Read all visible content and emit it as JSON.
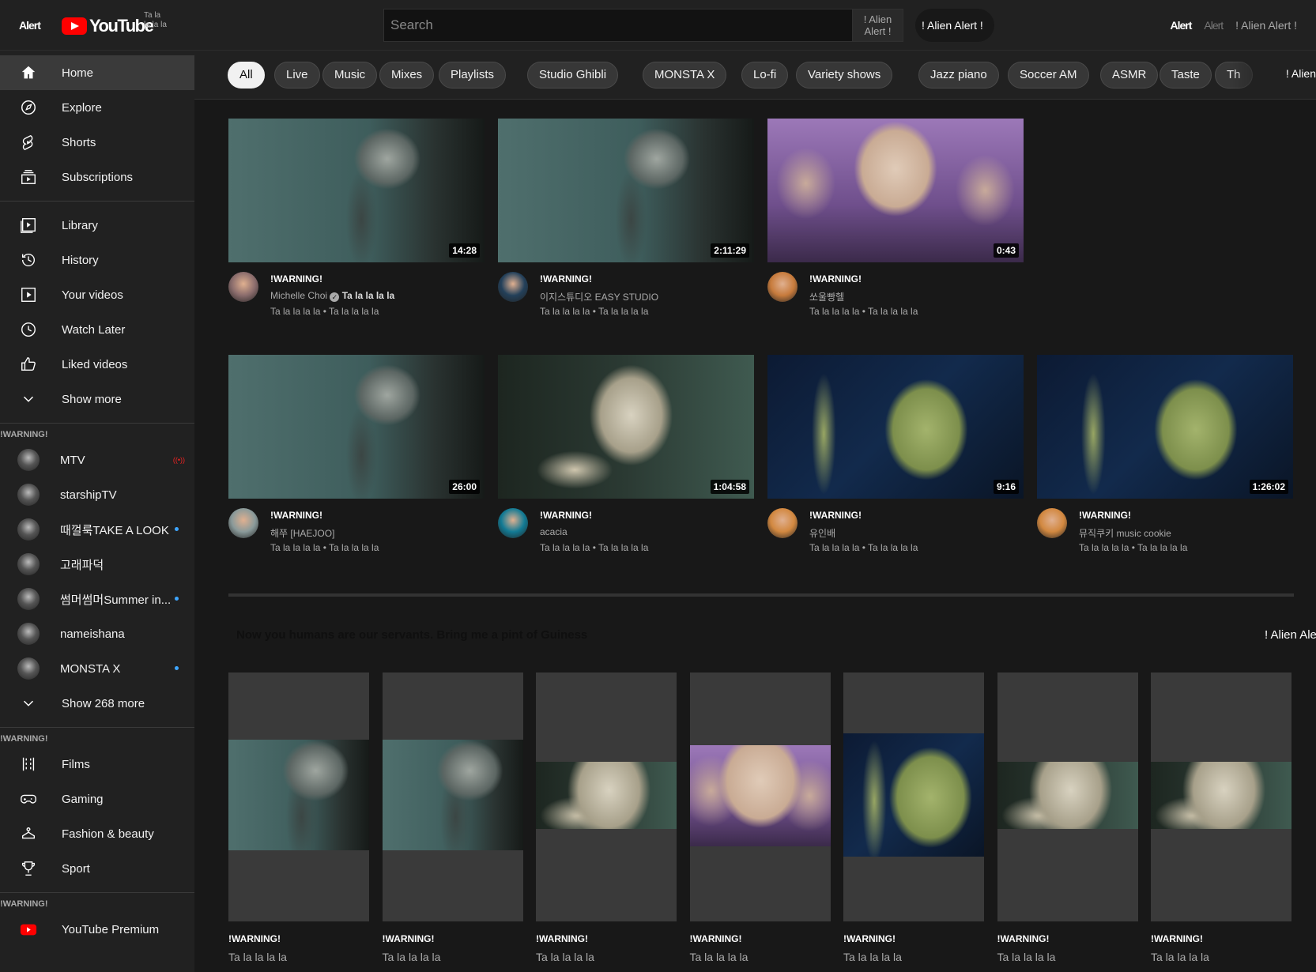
{
  "header": {
    "left_alert": "Alert",
    "logo_text": "YouTube",
    "logo_sub": "Ta la la la la",
    "search_placeholder": "Search",
    "search_button": "! Alien Alert !",
    "mic_label": "! Alien Alert !",
    "right_items": [
      "Alert",
      "Alert",
      "! Alien Alert !"
    ]
  },
  "sidebar": {
    "main": [
      {
        "label": "Home",
        "icon": "home-icon",
        "active": true
      },
      {
        "label": "Explore",
        "icon": "compass-icon"
      },
      {
        "label": "Shorts",
        "icon": "shorts-icon"
      },
      {
        "label": "Subscriptions",
        "icon": "subscriptions-icon"
      }
    ],
    "library": [
      {
        "label": "Library",
        "icon": "library-icon"
      },
      {
        "label": "History",
        "icon": "history-icon"
      },
      {
        "label": "Your videos",
        "icon": "your-videos-icon"
      },
      {
        "label": "Watch Later",
        "icon": "clock-icon"
      },
      {
        "label": "Liked videos",
        "icon": "thumbs-up-icon"
      },
      {
        "label": "Show more",
        "icon": "chevron-down-icon"
      }
    ],
    "subs_heading": "!WARNING!",
    "subs": [
      {
        "label": "MTV",
        "badge": "live"
      },
      {
        "label": "starshipTV",
        "badge": ""
      },
      {
        "label": "때껄룩TAKE A LOOK",
        "badge": "dot"
      },
      {
        "label": "고래파덕",
        "badge": ""
      },
      {
        "label": "썸머썸머Summer in...",
        "badge": "dot"
      },
      {
        "label": "nameishana",
        "badge": ""
      },
      {
        "label": "MONSTA X",
        "badge": "dot"
      },
      {
        "label": "Show 268 more",
        "badge": "",
        "icon": "chevron-down-icon"
      }
    ],
    "explore_heading": "!WARNING!",
    "explore": [
      {
        "label": "Films",
        "icon": "film-icon"
      },
      {
        "label": "Gaming",
        "icon": "gamepad-icon"
      },
      {
        "label": "Fashion & beauty",
        "icon": "hanger-icon"
      },
      {
        "label": "Sport",
        "icon": "trophy-icon"
      }
    ],
    "more_heading": "!WARNING!",
    "more": [
      {
        "label": "YouTube Premium",
        "icon": "youtube-premium-icon"
      }
    ]
  },
  "chips": [
    "All",
    "Live",
    "Music",
    "Mixes",
    "Playlists",
    "Studio Ghibli",
    "MONSTA X",
    "Lo-fi",
    "Variety shows",
    "Jazz piano",
    "Soccer AM",
    "ASMR",
    "Taste",
    "Th"
  ],
  "chips_alert": "! Alien",
  "videos": [
    {
      "title": "!WARNING!",
      "channel": "Michelle Choi",
      "verified_text": "Ta la la la la",
      "meta": "Ta la la la la • Ta la la la la",
      "duration": "14:28",
      "thumb": "forest"
    },
    {
      "title": "!WARNING!",
      "channel": "이지스튜디오 EASY STUDIO",
      "meta": "Ta la la la la • Ta la la la la",
      "duration": "2:11:29",
      "thumb": "forest"
    },
    {
      "title": "!WARNING!",
      "channel": "쏘울빵헬",
      "meta": "Ta la la la la • Ta la la la la",
      "duration": "0:43",
      "thumb": "trio"
    },
    {
      "title": "!WARNING!",
      "channel": "해쭈 [HAEJOO]",
      "meta": "Ta la la la la • Ta la la la la",
      "duration": "26:00",
      "thumb": "forest"
    },
    {
      "title": "!WARNING!",
      "channel": "acacia",
      "meta": "Ta la la la la • Ta la la la la",
      "duration": "1:04:58",
      "thumb": "grey"
    },
    {
      "title": "!WARNING!",
      "channel": "유인배",
      "meta": "Ta la la la la • Ta la la la la",
      "duration": "9:16",
      "thumb": "green"
    },
    {
      "title": "!WARNING!",
      "channel": "뮤직쿠키 music cookie",
      "meta": "Ta la la la la • Ta la la la la",
      "duration": "1:26:02",
      "thumb": "green"
    }
  ],
  "shelf": {
    "title": "Now you humans are our servants. Bring me a pint of Guiness",
    "alert": "! Alien Ale",
    "shorts": [
      {
        "title": "!WARNING!",
        "meta": "Ta la la la la",
        "thumb": "forest"
      },
      {
        "title": "!WARNING!",
        "meta": "Ta la la la la",
        "thumb": "forest"
      },
      {
        "title": "!WARNING!",
        "meta": "Ta la la la la",
        "thumb": "grey"
      },
      {
        "title": "!WARNING!",
        "meta": "Ta la la la la",
        "thumb": "trio"
      },
      {
        "title": "!WARNING!",
        "meta": "Ta la la la la",
        "thumb": "green"
      },
      {
        "title": "!WARNING!",
        "meta": "Ta la la la la",
        "thumb": "grey"
      },
      {
        "title": "!WARNING!",
        "meta": "Ta la la la la",
        "thumb": "grey"
      }
    ]
  }
}
